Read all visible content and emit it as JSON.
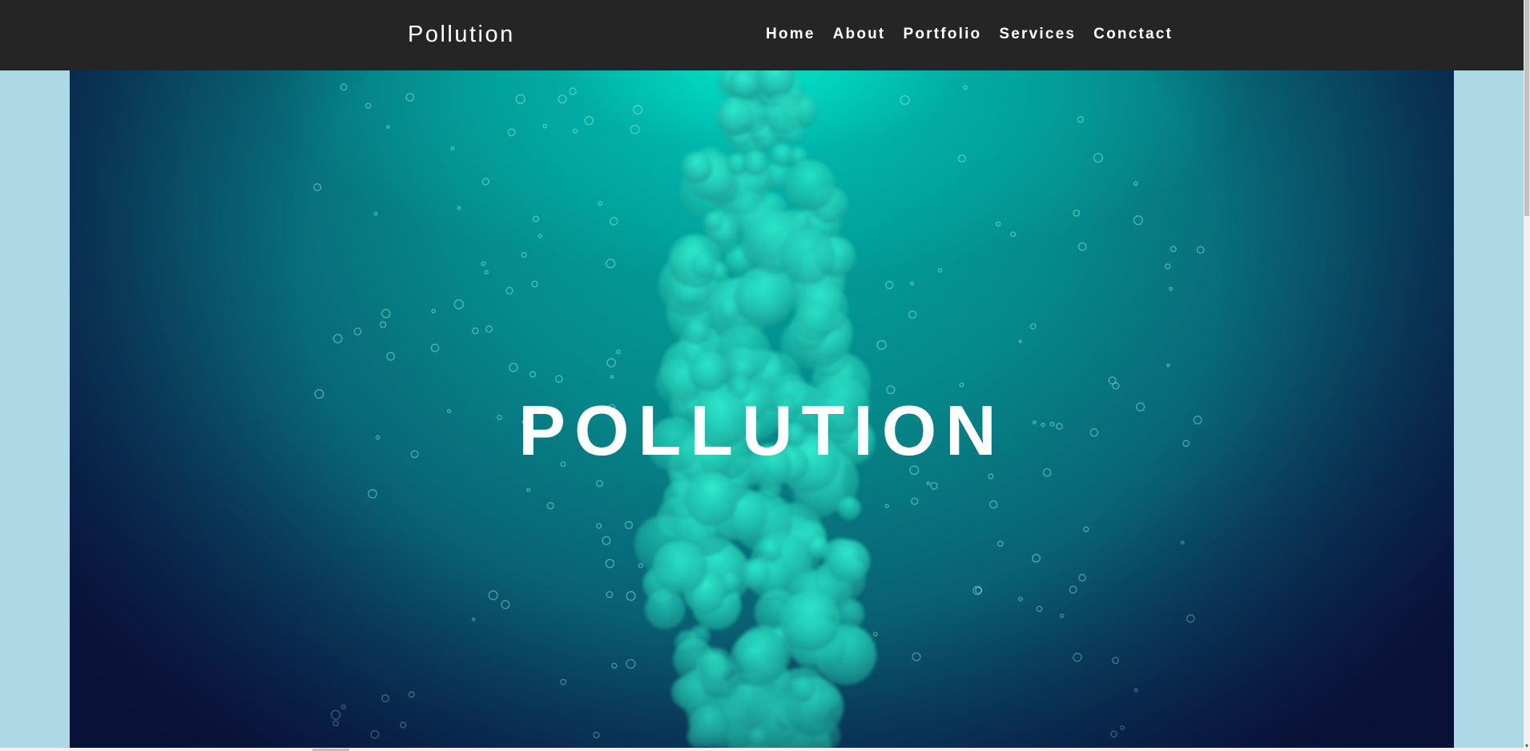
{
  "header": {
    "brand": "Pollution",
    "nav": [
      {
        "label": "Home"
      },
      {
        "label": "About"
      },
      {
        "label": "Portfolio"
      },
      {
        "label": "Services"
      },
      {
        "label": "Conctact"
      }
    ]
  },
  "hero": {
    "title": "POLLUTION",
    "image": "teal-ink-cloud-in-water"
  },
  "colors": {
    "page_background": "#add8e6",
    "navbar": "#252525",
    "text": "#ffffff",
    "hero_top": "#00e5c8",
    "hero_bottom": "#0c1640"
  }
}
